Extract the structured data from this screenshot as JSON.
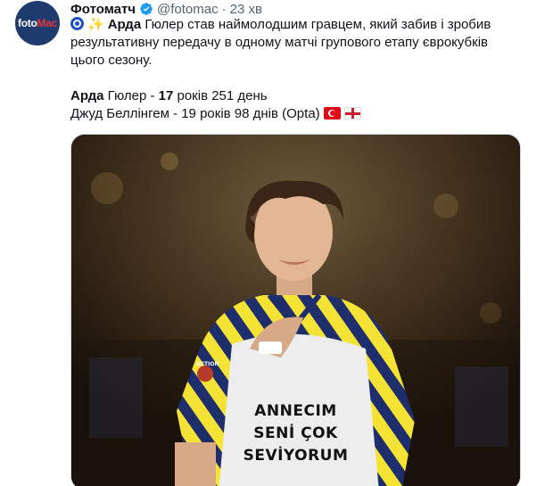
{
  "tweet": {
    "author_name": "Фотоматч",
    "handle": "@fotomac",
    "separator": "·",
    "time": "23 хв",
    "avatar_logo_main": "foto",
    "avatar_logo_accent": "Mac",
    "lines": {
      "l1_name": "Арда",
      "l1_rest": " Гюлер став наймолодшим гравцем, який забив і зробив",
      "l2": "результативну передачу в одному матчі групового етапу єврокубків",
      "l3": "цього сезону.",
      "l4_name": "Арда",
      "l4_mid": " Гюлер - ",
      "l4_num": "17",
      "l4_rest": " років 251 день",
      "l5": " Джуд Беллінгем - 19 років 98 днів (Opta)"
    },
    "media": {
      "shirt_line_1": "ANNECIM",
      "shirt_line_2": "SENİ ÇOK",
      "shirt_line_3": "SEVİYORUM",
      "patch_label": "ACTION"
    }
  },
  "colors": {
    "text": "#0f1419",
    "muted": "#536471",
    "verified": "#1d9bf0",
    "avatar_bg": "#1f3a6d"
  },
  "icons": [
    "nazar-eye-icon",
    "sparkles-icon",
    "verified-badge-icon",
    "turkey-flag-icon",
    "england-flag-icon"
  ]
}
